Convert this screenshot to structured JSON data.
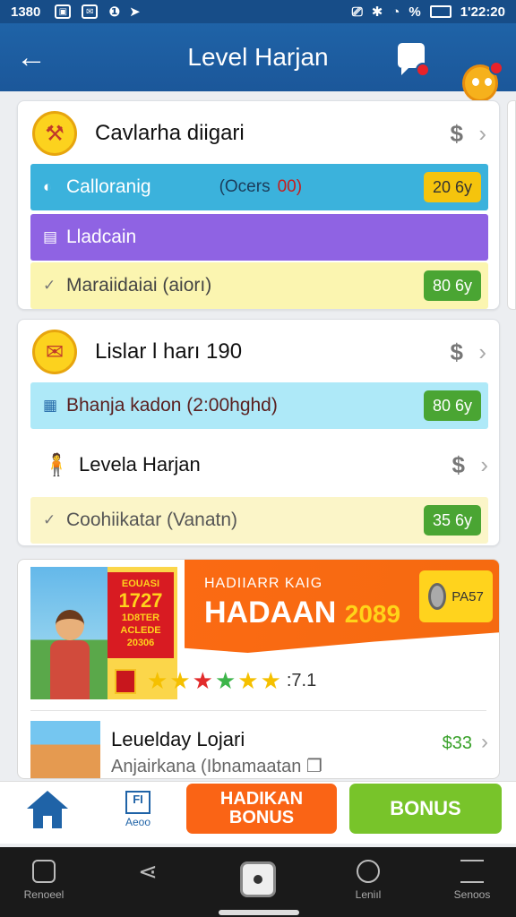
{
  "status_bar": {
    "time": "1380",
    "clock": "1'22:20",
    "battery": "%"
  },
  "app_bar": {
    "title": "Level Harjan"
  },
  "card1": {
    "title": "Cavlarha diigari",
    "rows": [
      {
        "label": "Calloranig",
        "note": "(Ocers",
        "note_red": "00)",
        "badge": "20 6y",
        "bg": "#3bb2dc",
        "badge_style": "yellow",
        "icon": "tag-icon"
      },
      {
        "label": "Lladcain",
        "bg": "#8f63e3",
        "icon": "list-icon"
      },
      {
        "label": "Maraiidaiai (aiorı)",
        "badge": "80 6y",
        "bg": "#fbf5b0",
        "badge_style": "green",
        "icon": "check-icon"
      }
    ]
  },
  "card2": {
    "title": "Lislar l harı 190",
    "rows": [
      {
        "label": "Bhanja kadon (2:00hghd)",
        "badge": "80 6y",
        "bg": "#aee9f8",
        "badge_style": "green",
        "icon": "calendar-icon"
      },
      {
        "label": "Levela Harjan",
        "icon": "character-icon"
      },
      {
        "label": "Coohiikatar (Vanatn)",
        "badge": "35 6y",
        "bg": "#fbf5c8",
        "badge_style": "green",
        "icon": "check-icon"
      }
    ]
  },
  "promo": {
    "poster_lines": [
      "EOUASI",
      "1727",
      "1D8TER",
      "ACLEDE",
      "20306"
    ],
    "headline_small": "HADIIARR KAIG",
    "headline_big": "HADAAN",
    "headline_year": "2089",
    "stamp_label": "PA57",
    "rating": ":7.1",
    "stars": [
      "#f5c000",
      "#f5c000",
      "#e22b2b",
      "#3db54a",
      "#f5c000",
      "#f5c000"
    ],
    "item_title": "Leuelday Lojari",
    "item_subtitle": "Anjairkana (Ibnamaatan",
    "item_price": "$33"
  },
  "tab_bar": {
    "about_icon_text": "FI",
    "about_label": "Aeoo",
    "orange_button": [
      "HADIKAN",
      "BONUS"
    ],
    "green_button": "BONUS"
  },
  "nav_bar": {
    "left_label": "Renoeel",
    "right1_label": "Leniıl",
    "right2_label": "Senoos"
  }
}
